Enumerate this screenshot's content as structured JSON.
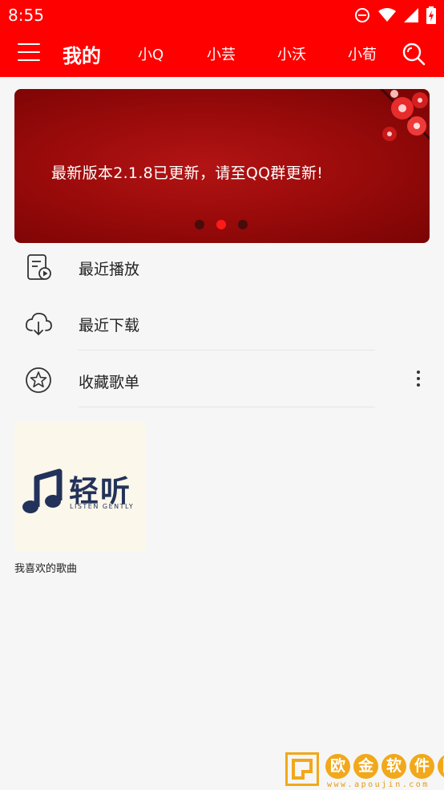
{
  "status_bar": {
    "time": "8:55",
    "icons": [
      "dnd-icon",
      "wifi-icon",
      "signal-icon",
      "battery-icon"
    ]
  },
  "top_bar": {
    "menu_icon": "menu-icon",
    "active_tab": "我的",
    "tabs": [
      "小Q",
      "小芸",
      "小沃",
      "小荀"
    ],
    "search_icon": "search-icon",
    "background_color": "#ff0000"
  },
  "banner": {
    "text": "最新版本2.1.8已更新，请至QQ群更新!",
    "dots": 3,
    "active_dot": 1,
    "accent_color": "#ff1a1a"
  },
  "menu": {
    "items": [
      {
        "label": "最近播放",
        "icon": "recent-play-icon"
      },
      {
        "label": "最近下载",
        "icon": "cloud-download-icon"
      },
      {
        "label": "收藏歌单",
        "icon": "star-icon"
      }
    ],
    "more_icon": "more-vertical-icon"
  },
  "playlists": [
    {
      "name": "我喜欢的歌曲",
      "cover_brand": "轻听",
      "cover_subtitle": "LISTEN GENTLY"
    }
  ],
  "watermark": {
    "chars": [
      "欧",
      "金",
      "软",
      "件",
      "园"
    ],
    "url": "www.apoujin.com"
  }
}
